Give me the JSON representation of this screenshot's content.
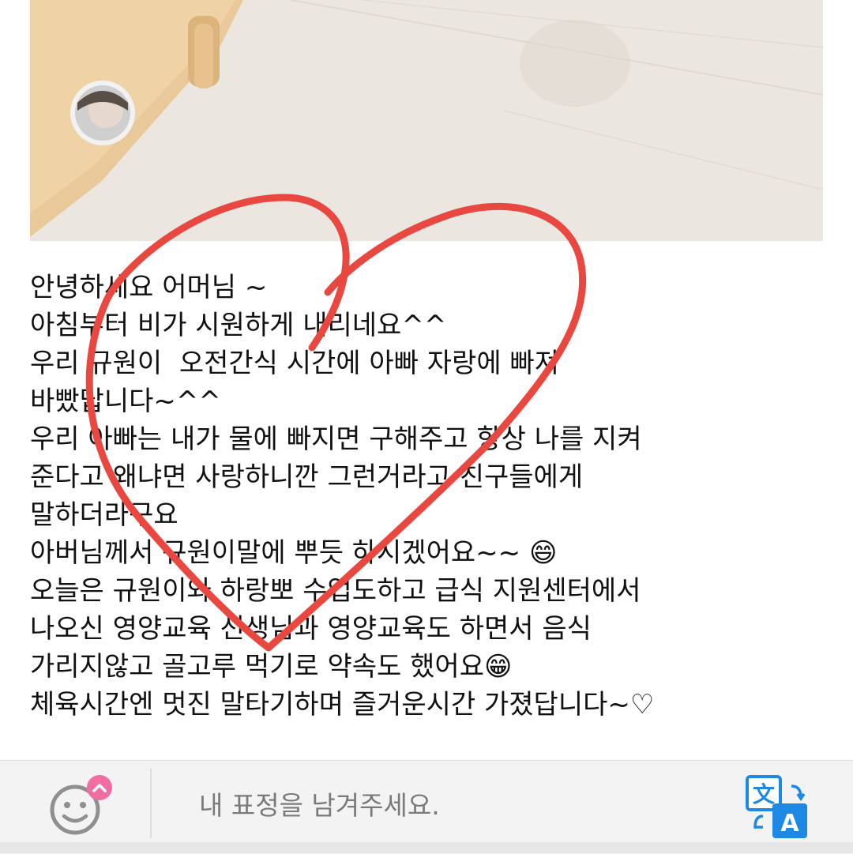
{
  "photo": {
    "description_icon": "classroom-floor-photo"
  },
  "message": {
    "lines": [
      "안녕하세요 어머님 ~",
      "아침부터 비가 시원하게 내리네요^^",
      "우리 규원이  오전간식 시간에 아빠 자랑에 빠져",
      "바빴답니다~^^",
      "우리 아빠는 내가 물에 빠지면 구해주고 항상 나를 지켜",
      "준다고 왜냐면 사랑하니깐 그런거라고 친구들에게",
      "말하더라구요",
      "아버님께서 규원이말에 뿌듯 하시겠어요~~ 😄",
      "오늘은 규원이와 하랑뽀 수업도하고 급식 지원센터에서",
      "나오신 영양교육 선생님과 영양교육도 하면서 음식",
      "가리지않고 골고루 먹기로 약속도 했어요😁",
      "체육시간엔 멋진 말타기하며 즐거운시간 가졌답니다~♡"
    ]
  },
  "bottom_bar": {
    "emoji_icon": "smiley-icon",
    "badge_icon": "chevron-up-icon",
    "placeholder": "내 표정을 남겨주세요.",
    "translate_icon": "translate-icon",
    "translate_glyph_top": "文",
    "translate_glyph_bottom": "A"
  },
  "colors": {
    "heart_stroke": "#e8483f",
    "badge_pink": "#f06ea4",
    "translate_blue": "#1e88e5"
  }
}
